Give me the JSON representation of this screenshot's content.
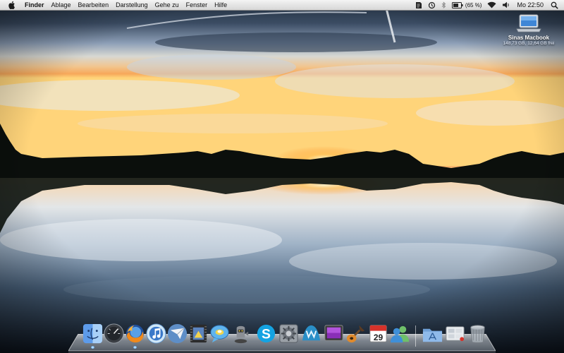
{
  "menubar": {
    "app_name": "Finder",
    "items": [
      "Ablage",
      "Bearbeiten",
      "Darstellung",
      "Gehe zu",
      "Fenster",
      "Hilfe"
    ],
    "battery_text": "(65 %)",
    "clock": "Mo 22:50",
    "status_icons": [
      "script-icon",
      "time-machine-icon",
      "bluetooth-icon",
      "battery-icon",
      "wifi-icon",
      "volume-icon",
      "spotlight-icon"
    ]
  },
  "desktop": {
    "drive": {
      "name": "Sinas Macbook",
      "info": "148,73 GB, 12,64 GB frei"
    }
  },
  "dock": {
    "items": [
      {
        "name": "finder",
        "running": true
      },
      {
        "name": "dashboard",
        "running": false
      },
      {
        "name": "firefox",
        "running": true
      },
      {
        "name": "itunes",
        "running": false
      },
      {
        "name": "mail",
        "running": false
      },
      {
        "name": "imovie",
        "running": false
      },
      {
        "name": "ichat",
        "running": false
      },
      {
        "name": "automator",
        "running": false
      },
      {
        "name": "skype",
        "running": false
      },
      {
        "name": "system-preferences",
        "running": false
      },
      {
        "name": "dreamweaver",
        "running": false
      },
      {
        "name": "screensaver",
        "running": false
      },
      {
        "name": "garageband",
        "running": false
      },
      {
        "name": "ical",
        "running": false
      },
      {
        "name": "address-book",
        "running": false
      },
      {
        "name": "applications-folder",
        "running": false
      },
      {
        "name": "downloads-stack",
        "running": false
      },
      {
        "name": "trash",
        "running": false
      }
    ],
    "ical_day": "29"
  }
}
